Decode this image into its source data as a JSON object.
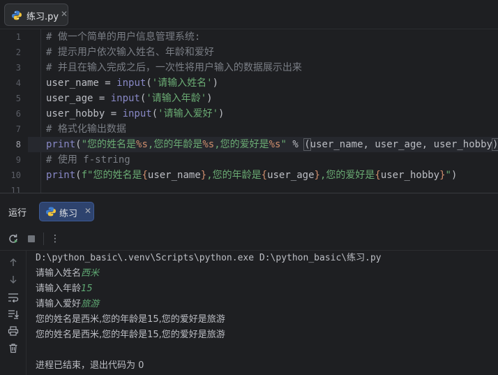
{
  "editor_tab": {
    "filename": "练习.py",
    "close": "✕"
  },
  "editor": {
    "lines": [
      {
        "num": "1",
        "segments": [
          {
            "t": "# 做一个简单的用户信息管理系统:",
            "c": "comment"
          }
        ]
      },
      {
        "num": "2",
        "segments": [
          {
            "t": "# 提示用户依次输入姓名、年龄和爱好",
            "c": "comment"
          }
        ]
      },
      {
        "num": "3",
        "segments": [
          {
            "t": "# 并且在输入完成之后，一次性将用户输入的数据展示出来",
            "c": "comment"
          }
        ]
      },
      {
        "num": "4",
        "segments": [
          {
            "t": "user_name = ",
            "c": "default"
          },
          {
            "t": "input",
            "c": "builtin"
          },
          {
            "t": "(",
            "c": "default"
          },
          {
            "t": "'请输入姓名'",
            "c": "string"
          },
          {
            "t": ")",
            "c": "default"
          }
        ]
      },
      {
        "num": "5",
        "segments": [
          {
            "t": "user_age = ",
            "c": "default"
          },
          {
            "t": "input",
            "c": "builtin"
          },
          {
            "t": "(",
            "c": "default"
          },
          {
            "t": "'请输入年龄'",
            "c": "string"
          },
          {
            "t": ")",
            "c": "default"
          }
        ]
      },
      {
        "num": "6",
        "segments": [
          {
            "t": "user_hobby = ",
            "c": "default"
          },
          {
            "t": "input",
            "c": "builtin"
          },
          {
            "t": "(",
            "c": "default"
          },
          {
            "t": "'请输入爱好'",
            "c": "string"
          },
          {
            "t": ")",
            "c": "default"
          }
        ]
      },
      {
        "num": "7",
        "segments": [
          {
            "t": "# 格式化输出数据",
            "c": "comment"
          }
        ]
      },
      {
        "num": "8",
        "segments": [
          {
            "t": "print",
            "c": "builtin"
          },
          {
            "t": "(",
            "c": "default"
          },
          {
            "t": "\"您的姓名是",
            "c": "string"
          },
          {
            "t": "%s",
            "c": "format"
          },
          {
            "t": ",您的年龄是",
            "c": "string"
          },
          {
            "t": "%s",
            "c": "format"
          },
          {
            "t": ",您的爱好是",
            "c": "string"
          },
          {
            "t": "%s",
            "c": "format"
          },
          {
            "t": "\"",
            "c": "string"
          },
          {
            "t": " % ",
            "c": "default"
          },
          {
            "t": "(",
            "c": "paren-hl"
          },
          {
            "t": "user_name, user_age, user_hobby",
            "c": "default"
          },
          {
            "t": ")",
            "c": "paren-hl"
          },
          {
            "t": ")",
            "c": "default"
          }
        ]
      },
      {
        "num": "9",
        "segments": [
          {
            "t": "# 使用 f-string",
            "c": "comment"
          }
        ]
      },
      {
        "num": "10",
        "segments": [
          {
            "t": "print",
            "c": "builtin"
          },
          {
            "t": "(",
            "c": "default"
          },
          {
            "t": "f\"您的姓名是",
            "c": "string"
          },
          {
            "t": "{",
            "c": "brace"
          },
          {
            "t": "user_name",
            "c": "default"
          },
          {
            "t": "}",
            "c": "brace"
          },
          {
            "t": ",您的年龄是",
            "c": "string"
          },
          {
            "t": "{",
            "c": "brace"
          },
          {
            "t": "user_age",
            "c": "default"
          },
          {
            "t": "}",
            "c": "brace"
          },
          {
            "t": ",您的爱好是",
            "c": "string"
          },
          {
            "t": "{",
            "c": "brace"
          },
          {
            "t": "user_hobby",
            "c": "default"
          },
          {
            "t": "}",
            "c": "brace"
          },
          {
            "t": "\"",
            "c": "string"
          },
          {
            "t": ")",
            "c": "default"
          }
        ]
      },
      {
        "num": "11",
        "segments": []
      }
    ],
    "active_line": "8"
  },
  "run_panel": {
    "title": "运行",
    "tab_label": "练习",
    "tab_close": "✕",
    "toolbar": {
      "rerun_icon": "rerun-icon",
      "stop_icon": "stop-icon",
      "more": "⋮"
    },
    "side_tools": [
      "arrow-up-icon",
      "arrow-down-icon",
      "soft-wrap-icon",
      "scroll-to-end-icon",
      "print-icon",
      "trash-icon"
    ],
    "console": [
      {
        "text": "D:\\python_basic\\.venv\\Scripts\\python.exe D:\\python_basic\\练习.py"
      },
      {
        "prompt": "请输入姓名",
        "input": "西米"
      },
      {
        "prompt": "请输入年龄",
        "input": "15"
      },
      {
        "prompt": "请输入爱好",
        "input": "旅游"
      },
      {
        "text": "您的姓名是西米,您的年龄是15,您的爱好是旅游"
      },
      {
        "text": "您的姓名是西米,您的年龄是15,您的爱好是旅游"
      },
      {
        "text": ""
      },
      {
        "text": "进程已结束，退出代码为 0"
      }
    ]
  },
  "colors": {
    "background": "#1e1f22",
    "comment": "#7a7e85",
    "string": "#6aab73",
    "builtin": "#8888c6",
    "format": "#cf8e6d",
    "console_input": "#5fa873",
    "run_tab_bg": "#2e436e"
  }
}
